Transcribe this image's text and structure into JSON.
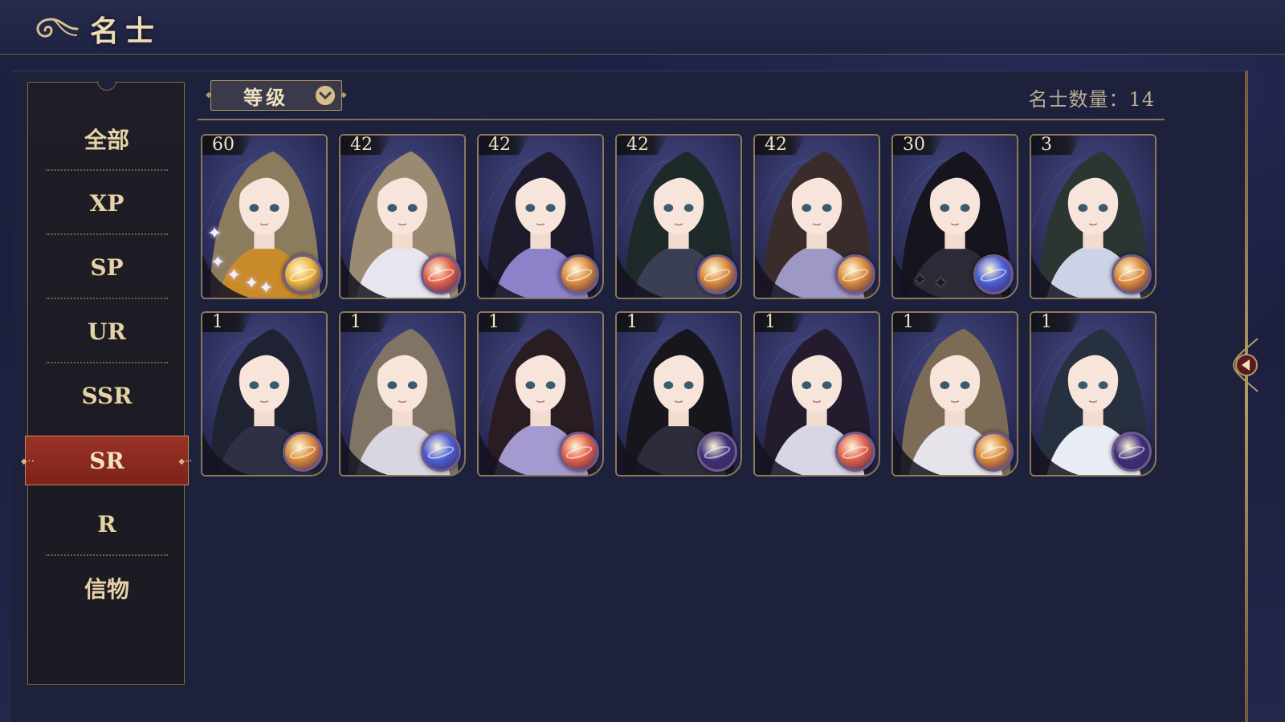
{
  "header": {
    "title": "名士"
  },
  "sidebar": {
    "items": [
      {
        "label": "全部",
        "active": false
      },
      {
        "label": "XP",
        "active": false
      },
      {
        "label": "SP",
        "active": false
      },
      {
        "label": "UR",
        "active": false
      },
      {
        "label": "SSR",
        "active": false
      },
      {
        "label": "SR",
        "active": true
      },
      {
        "label": "R",
        "active": false
      },
      {
        "label": "信物",
        "active": false
      }
    ]
  },
  "filter": {
    "label": "等级",
    "icon": "chevron-down-icon"
  },
  "count": {
    "text": "名士数量：14"
  },
  "cards": [
    {
      "level": "60",
      "orb": "gold",
      "sparkles": "light",
      "hair": "#8c7c5e",
      "outfit": "#c98b2a"
    },
    {
      "level": "42",
      "orb": "red",
      "sparkles": "",
      "hair": "#9a8a72",
      "outfit": "#e8e5ef"
    },
    {
      "level": "42",
      "orb": "orange",
      "sparkles": "",
      "hair": "#1d1a2b",
      "outfit": "#8b82c9"
    },
    {
      "level": "42",
      "orb": "orange",
      "sparkles": "",
      "hair": "#1e2a2a",
      "outfit": "#3b3f54"
    },
    {
      "level": "42",
      "orb": "orange",
      "sparkles": "",
      "hair": "#3a2c2a",
      "outfit": "#9d98c6"
    },
    {
      "level": "30",
      "orb": "blue",
      "sparkles": "dark",
      "hair": "#16141d",
      "outfit": "#2b2a36"
    },
    {
      "level": "3",
      "orb": "orange",
      "sparkles": "",
      "hair": "#2b3532",
      "outfit": "#cdd3e6"
    },
    {
      "level": "1",
      "orb": "orange",
      "sparkles": "",
      "hair": "#1f2230",
      "outfit": "#2e3144"
    },
    {
      "level": "1",
      "orb": "blue",
      "sparkles": "",
      "hair": "#807565",
      "outfit": "#d9d6e2"
    },
    {
      "level": "1",
      "orb": "red",
      "sparkles": "",
      "hair": "#2a1d22",
      "outfit": "#a59ad0"
    },
    {
      "level": "1",
      "orb": "purple",
      "sparkles": "",
      "hair": "#17161d",
      "outfit": "#2d2c3a"
    },
    {
      "level": "1",
      "orb": "red",
      "sparkles": "",
      "hair": "#241c2e",
      "outfit": "#d8d6e5"
    },
    {
      "level": "1",
      "orb": "orange",
      "sparkles": "",
      "hair": "#7d6c55",
      "outfit": "#e7e3ea"
    },
    {
      "level": "1",
      "orb": "purple",
      "sparkles": "",
      "hair": "#26303f",
      "outfit": "#e8ecf4"
    }
  ],
  "colors": {
    "orb_gold": "#e9b43c",
    "orb_red": "#e0604a",
    "orb_orange": "#d98a3a",
    "orb_blue": "#4a5fd8",
    "orb_purple": "#3d2f78",
    "active_tab": "#8d2a20",
    "gold_text": "#e6d2a5"
  }
}
